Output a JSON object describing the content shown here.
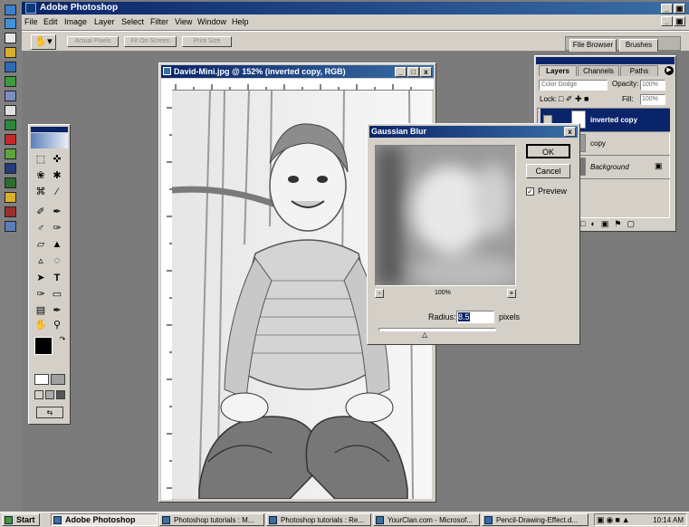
{
  "app": {
    "title": "Adobe Photoshop"
  },
  "window_controls": {
    "minimize": "_",
    "restore": "3",
    "close": "x"
  },
  "menu": [
    "File",
    "Edit",
    "Image",
    "Layer",
    "Select",
    "Filter",
    "View",
    "Window",
    "Help"
  ],
  "options_bar": {
    "buttons": [
      "Actual Pixels",
      "Fit On Screen",
      "Print Size"
    ],
    "well_tabs": [
      "File Browser",
      "Brushes"
    ]
  },
  "document": {
    "title": "David-Mini.jpg @ 152% (inverted copy, RGB)"
  },
  "layers_palette": {
    "tabs": [
      "Layers",
      "Channels",
      "Paths"
    ],
    "blend_mode": "Color Dodge",
    "opacity_label": "Opacity:",
    "opacity_value": "100%",
    "lock_label": "Lock:",
    "fill_label": "Fill:",
    "fill_value": "100%",
    "layers": [
      {
        "name": "inverted copy",
        "selected": true
      },
      {
        "name": "copy",
        "selected": false
      },
      {
        "name": "Background",
        "selected": false
      }
    ]
  },
  "gaussian_blur": {
    "title": "Gaussian Blur",
    "ok_label": "OK",
    "cancel_label": "Cancel",
    "preview_label": "Preview",
    "preview_checked": true,
    "zoom_label": "100%",
    "zoom_out": "-",
    "zoom_in": "+",
    "radius_label": "Radius:",
    "radius_value": "8.5",
    "radius_unit": "pixels"
  },
  "taskbar": {
    "start_label": "Start",
    "tasks": [
      "Adobe Photoshop",
      "Photoshop tutorials : M...",
      "Photoshop tutorials : Re...",
      "YourClan.com - Microsof...",
      "Pencil-Drawing-Effect.d..."
    ],
    "clock": "10:14 AM"
  },
  "colors": {
    "title_blue": "#0a246a",
    "chrome": "#d4d0c8",
    "desktop": "#7b7b7b"
  }
}
